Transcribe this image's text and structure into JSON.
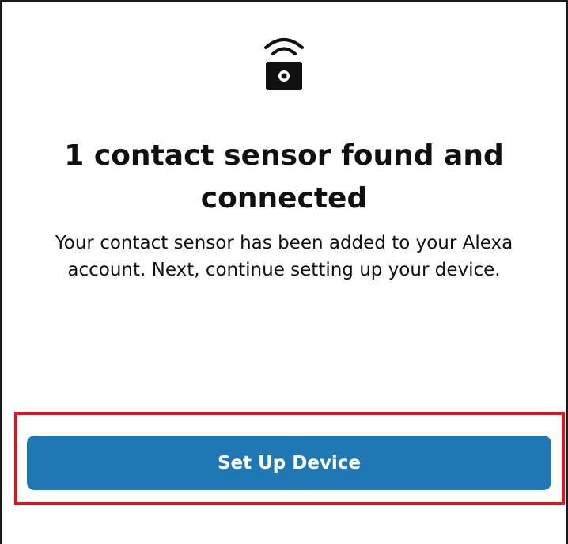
{
  "header": {
    "icon": "contact-sensor-wireless-icon"
  },
  "content": {
    "title": "1 contact sensor found and connected",
    "description": "Your contact sensor has been added to your Alexa account. Next, continue setting up your device."
  },
  "actions": {
    "primary_label": "Set Up Device"
  },
  "colors": {
    "primary_button": "#1f77b4",
    "highlight_border": "#e0141e",
    "text": "#0f1111",
    "background": "#ffffff"
  }
}
